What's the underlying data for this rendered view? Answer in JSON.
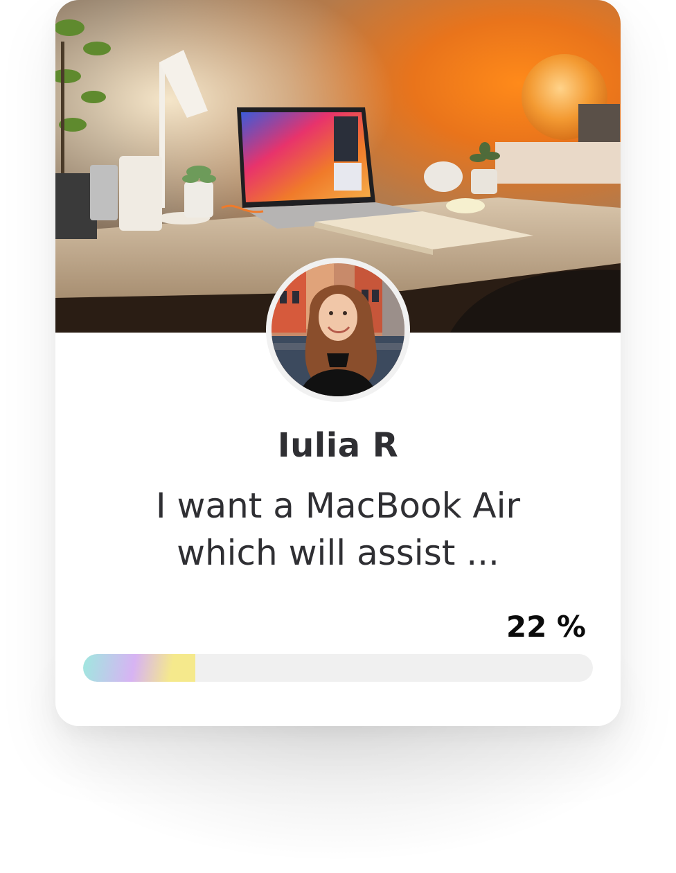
{
  "profile": {
    "name": "Iulia R",
    "message": "I want a MacBook Air which will assist ...",
    "cover_image": "desk-laptop-photo",
    "avatar_image": "woman-portrait-photo"
  },
  "progress": {
    "label": "22 %",
    "value_percent": 22,
    "gradient": [
      "#9fe8df",
      "#d7b3f3",
      "#f5e98c"
    ],
    "track_color": "#f0f0f0"
  }
}
